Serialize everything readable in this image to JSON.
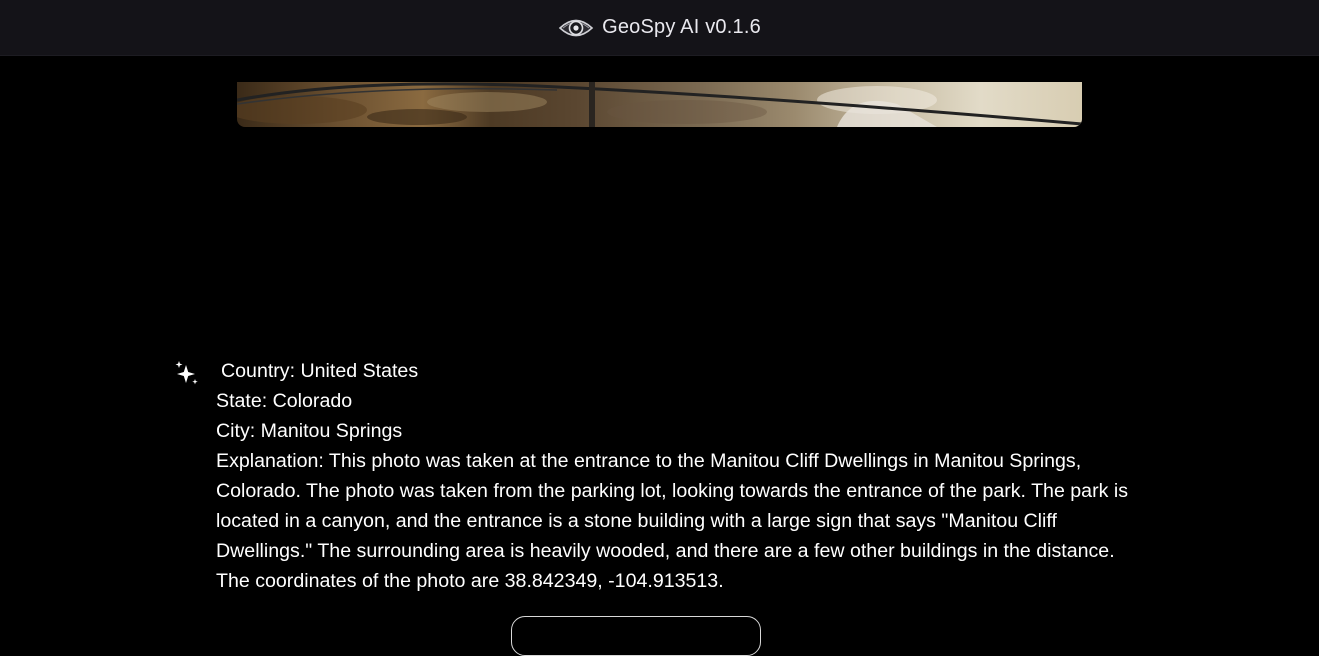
{
  "header": {
    "title": "GeoSpy AI v0.1.6",
    "logo_icon": "eye-icon"
  },
  "result": {
    "icon": "sparkle-icon",
    "country": "Country: United States",
    "state": "State: Colorado",
    "city": "City: Manitou Springs",
    "explanation": "Explanation: This photo was taken at the entrance to the Manitou Cliff Dwellings in Manitou Springs, Colorado. The photo was taken from the parking lot, looking towards the entrance of the park. The park is located in a canyon, and the entrance is a stone building with a large sign that says \"Manitou Cliff Dwellings.\" The surrounding area is heavily wooded, and there are a few other buildings in the distance. The coordinates of the photo are 38.842349, -104.913513."
  },
  "colors": {
    "background": "#000000",
    "header_bg": "#141318",
    "text": "#ffffff"
  }
}
